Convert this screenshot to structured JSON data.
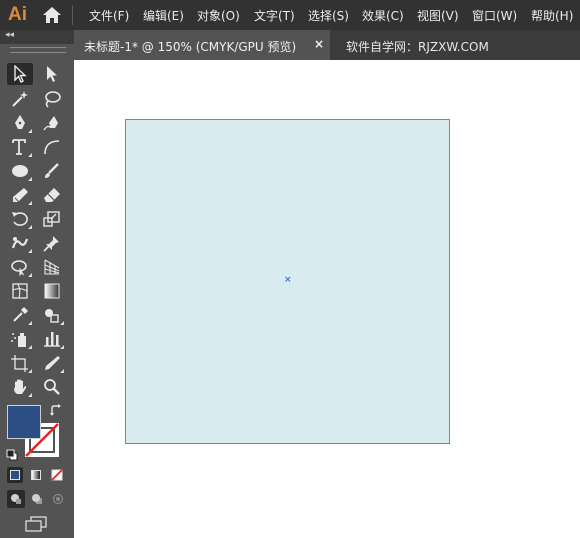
{
  "app": {
    "logo": "Ai"
  },
  "menu": [
    "文件(F)",
    "编辑(E)",
    "对象(O)",
    "文字(T)",
    "选择(S)",
    "效果(C)",
    "视图(V)",
    "窗口(W)",
    "帮助(H)"
  ],
  "tabs": [
    {
      "label": "未标题-1* @ 150% (CMYK/GPU 预览)",
      "close": "×"
    },
    {
      "label": "软件自学网：RJZXW.COM"
    }
  ],
  "toolbar": {
    "collapse": "◂◂",
    "tools": [
      "selection-tool",
      "direct-selection-tool",
      "magic-wand-tool",
      "lasso-tool",
      "pen-tool",
      "curvature-tool",
      "type-tool",
      "arc-tool",
      "ellipse-tool",
      "paintbrush-tool",
      "shaper-tool",
      "eraser-tool",
      "rotate-tool",
      "scale-tool",
      "puppet-warp-tool",
      "pin-tool",
      "free-transform-tool",
      "perspective-grid-tool",
      "mesh-tool",
      "gradient-tool",
      "eyedropper-tool",
      "shape-builder-tool",
      "symbol-sprayer-tool",
      "column-graph-tool",
      "artboard-tool",
      "slice-tool",
      "hand-tool",
      "zoom-tool"
    ]
  },
  "colors": {
    "fill": "#2d4f86",
    "stroke": "none",
    "artboard_fill": "#d8ecef",
    "selection": "#4d8fd2"
  },
  "canvas": {
    "center_mark": "×"
  }
}
